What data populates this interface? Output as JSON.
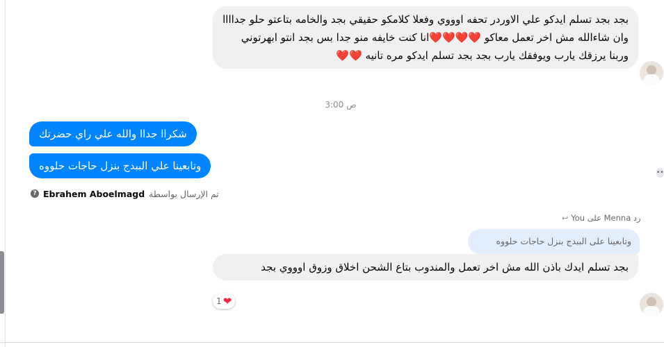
{
  "messages": {
    "incoming_long": "بجد بجد تسلم ايدكو علي الاوردر تحفه اوووي وفعلا كلامكو حقيقي بجد والخامه بتاعتو حلو جداااا وان شاءالله مش اخر تعمل معاكو ❤️❤️❤️❤️انا كنت خايفه منو جدا بس بجد انتو ابهرتوني وربنا يرزقك يارب ويوفقك يارب بجد بجد تسلم ايدكو مره تانيه ❤️❤️",
    "timestamp": "3:00 ص",
    "outgoing_1": "شكراا جداا والله علي راي حضرتك",
    "outgoing_2": "وتابعينا علي الببدج بنزل حاجات حلووه",
    "sent_by_label": "تم الإرسال بواسطة",
    "sender_name": "Ebrahem Aboelmagd",
    "reply_label": "رد Menna على You",
    "quoted_text": "وتابعينا على الببدج بنزل حاجات حلووه",
    "incoming_reply": "بجد تسلم ايدك باذن الله مش اخر تعمل والمندوب بتاع الشحن اخلاق وزوق اوووي بجد",
    "reaction_count": "1",
    "reaction_emoji": "❤"
  },
  "colors": {
    "outgoing_bubble": "#0084ff",
    "incoming_bubble": "#f0f0f0",
    "quoted_bubble": "#e3eefc",
    "heart": "#f02849"
  },
  "icons": {
    "info": "info-circle-icon",
    "reply": "reply-arrow-icon",
    "heart": "heart-icon"
  }
}
